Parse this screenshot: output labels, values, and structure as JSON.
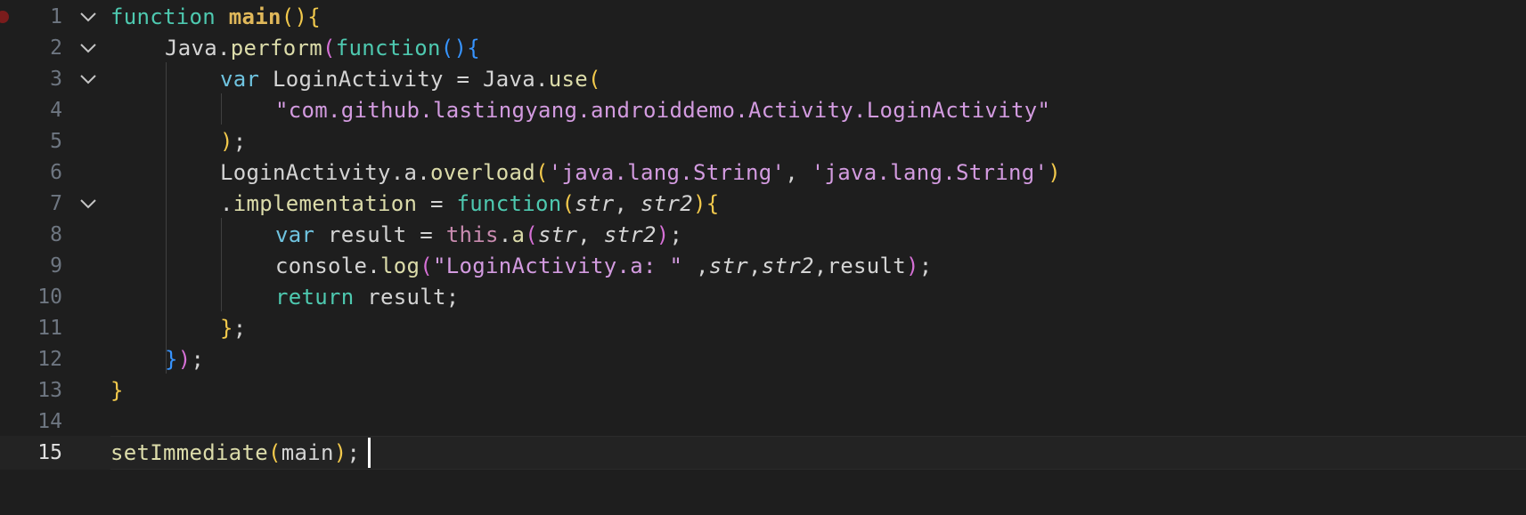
{
  "editor": {
    "current_line": 15,
    "lines": [
      {
        "n": "1"
      },
      {
        "n": "2"
      },
      {
        "n": "3"
      },
      {
        "n": "4"
      },
      {
        "n": "5"
      },
      {
        "n": "6"
      },
      {
        "n": "7"
      },
      {
        "n": "8"
      },
      {
        "n": "9"
      },
      {
        "n": "10"
      },
      {
        "n": "11"
      },
      {
        "n": "12"
      },
      {
        "n": "13"
      },
      {
        "n": "14"
      },
      {
        "n": "15"
      }
    ],
    "tokens": {
      "l1": [
        "function",
        " ",
        "main",
        "(",
        ")",
        "{"
      ],
      "l2": [
        "Java.",
        "perform",
        "(",
        "function",
        "(",
        ")",
        "{"
      ],
      "l3": [
        "var",
        " LoginActivity = Java.",
        "use",
        "("
      ],
      "l4": [
        "\"com.github.lastingyang.androiddemo.Activity.LoginActivity\""
      ],
      "l5": [
        ")",
        ";"
      ],
      "l6": [
        "LoginActivity.a.",
        "overload",
        "(",
        "'java.lang.String'",
        ", ",
        "'java.lang.String'",
        ")"
      ],
      "l7": [
        ".",
        "implementation",
        " = ",
        "function",
        "(",
        "str",
        ", ",
        "str2",
        ")",
        "{"
      ],
      "l8": [
        "var",
        " result = ",
        "this",
        ".",
        "a",
        "(",
        "str",
        ", ",
        "str2",
        ")",
        ";"
      ],
      "l9": [
        "console.",
        "log",
        "(",
        "\"LoginActivity.a: \"",
        " ,",
        "str",
        ",",
        "str2",
        ",result",
        ")",
        ";"
      ],
      "l10": [
        "return",
        " result;"
      ],
      "l11": [
        "}",
        ";"
      ],
      "l12": [
        "}",
        ")",
        ";"
      ],
      "l13": [
        "}"
      ],
      "l14": [],
      "l15": [
        "setImmediate",
        "(",
        "main",
        ")",
        ";"
      ]
    }
  },
  "colors": {
    "background": "#1e1e1e",
    "keyword": "#6fc3df",
    "function_name": "#dcdcaa",
    "string": "#d39be0",
    "bracket_yellow": "#f2c94c",
    "bracket_magenta": "#d670d6",
    "bracket_blue": "#3794ff",
    "breakpoint": "#7a1c1c"
  }
}
